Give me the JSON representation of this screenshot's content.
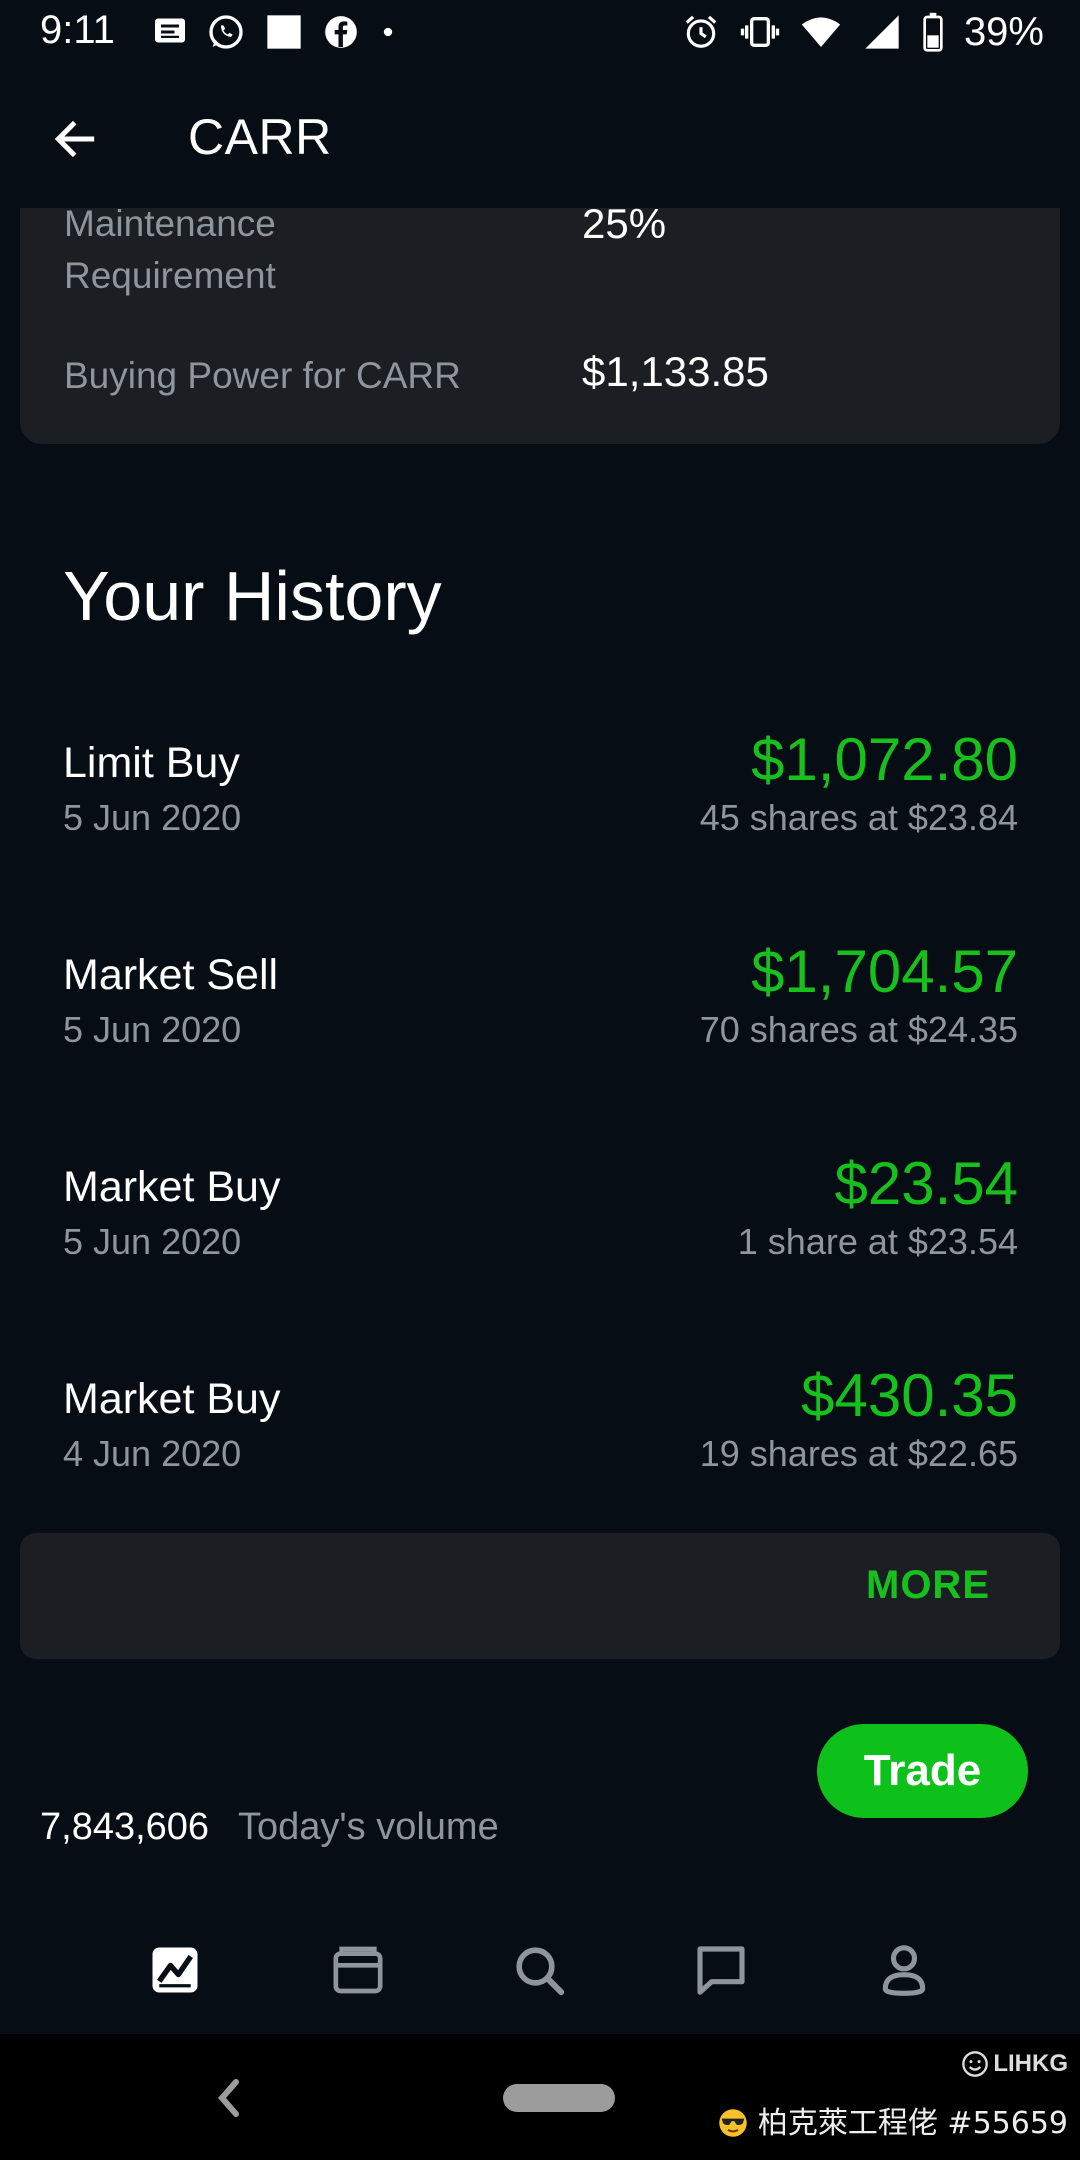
{
  "status_bar": {
    "time": "9:11",
    "battery_percent": "39%",
    "left_icons": [
      "messages-icon",
      "whatsapp-icon",
      "blank-notification-icon",
      "facebook-icon",
      "dot-icon"
    ],
    "right_icons": [
      "alarm-icon",
      "vibrate-icon",
      "wifi-icon",
      "signal-icon",
      "battery-icon"
    ]
  },
  "header": {
    "title": "CARR"
  },
  "margin_info": {
    "rows": [
      {
        "label": "Maintenance Requirement",
        "value": "25%"
      },
      {
        "label": "Buying Power for CARR",
        "value": "$1,133.85"
      }
    ]
  },
  "history": {
    "title": "Your History",
    "items": [
      {
        "type": "Limit Buy",
        "date": "5 Jun 2020",
        "amount": "$1,072.80",
        "detail": "45 shares at $23.84"
      },
      {
        "type": "Market Sell",
        "date": "5 Jun 2020",
        "amount": "$1,704.57",
        "detail": "70 shares at $24.35"
      },
      {
        "type": "Market Buy",
        "date": "5 Jun 2020",
        "amount": "$23.54",
        "detail": "1 share at $23.54"
      },
      {
        "type": "Market Buy",
        "date": "4 Jun 2020",
        "amount": "$430.35",
        "detail": "19 shares at $22.65"
      }
    ],
    "more_label": "MORE"
  },
  "trade_button": {
    "label": "Trade"
  },
  "volume": {
    "value": "7,843,606",
    "label": "Today's volume"
  },
  "bottom_nav": {
    "items": [
      "chart-icon",
      "wallet-icon",
      "search-icon",
      "chat-icon",
      "profile-icon"
    ],
    "active": "chart-icon"
  },
  "watermark": {
    "logo_text": "LIHKG",
    "text": "柏克萊工程佬 #55659"
  },
  "colors": {
    "background": "#060d14",
    "card": "#1b1f24",
    "accent_green": "#18c01e",
    "muted_text": "#8f959c"
  }
}
